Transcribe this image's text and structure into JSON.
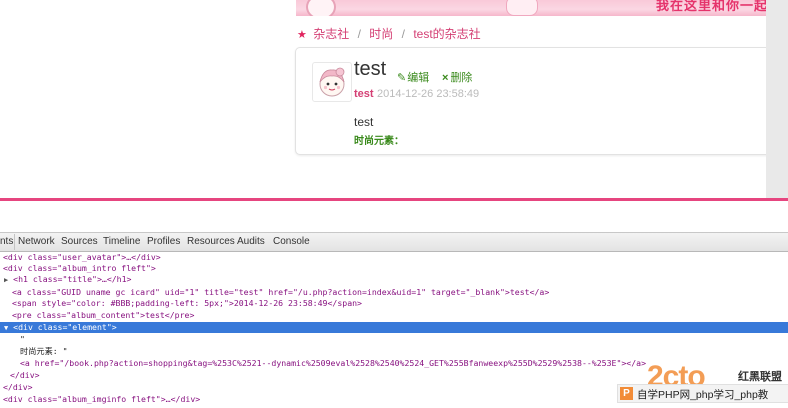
{
  "banner": {
    "text": "我在这里和你一起执"
  },
  "breadcrumb": {
    "items": [
      "杂志社",
      "时尚",
      "test的杂志社"
    ]
  },
  "post": {
    "title": "test",
    "edit_label": "编辑",
    "delete_label": "删除",
    "author": "test",
    "date": "2014-12-26 23:58:49",
    "content": "test",
    "fashion_label": "时尚元素："
  },
  "devtools": {
    "tabs": [
      "nts",
      "Network",
      "Sources",
      "Timeline",
      "Profiles",
      "Resources",
      "Audits",
      "Console"
    ],
    "lines": [
      "<div class=\"user_avatar\">…</div>",
      "<div class=\"album_intro fleft\">",
      "<h1 class=\"title\">…</h1>",
      "<a class=\"GUID uname gc icard\" uid=\"1\" title=\"test\" href=\"/u.php?action=index&uid=1\" target=\"_blank\">test</a>",
      "<span style=\"color: #BBB;padding-left: 5px;\">2014-12-26 23:58:49</span>",
      "<pre class=\"album_content\">test</pre>",
      "<div class=\"element\">",
      "\"",
      "时尚元素: \"",
      "<a href=\"/book.php?action=shopping&tag=%253C%2521--dynamic%2509eval%2528%2540%2524_GET%255Bfanweexp%255D%2529%2538--%253E\"></a>",
      "</div>",
      "</div>",
      "<div class=\"album_imginfo fleft\">…</div>"
    ]
  },
  "watermark": {
    "big": "2cto",
    "brand": "红黑联盟",
    "icon": "P",
    "text": "自学PHP网_php学习_php教"
  }
}
